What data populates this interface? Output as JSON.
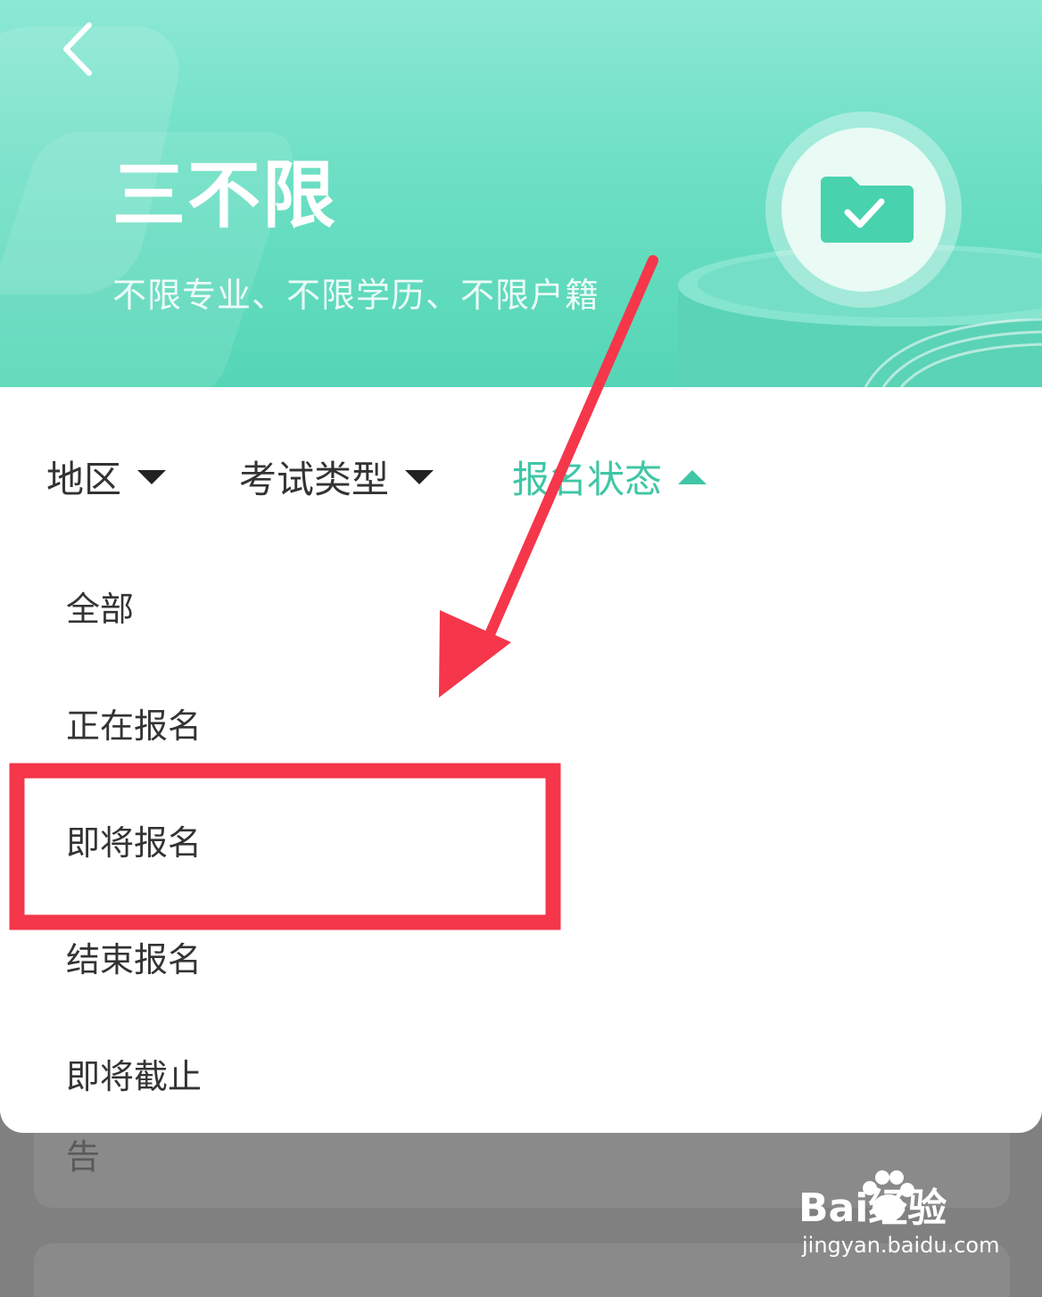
{
  "banner": {
    "title": "三不限",
    "subtitle": "不限专业、不限学历、不限户籍"
  },
  "filters": [
    {
      "label": "地区",
      "state": "collapsed"
    },
    {
      "label": "考试类型",
      "state": "collapsed"
    },
    {
      "label": "报名状态",
      "state": "expanded"
    }
  ],
  "dropdown": {
    "options": [
      "全部",
      "正在报名",
      "即将报名",
      "结束报名",
      "即将截止"
    ],
    "highlighted": "即将报名"
  },
  "background_list": {
    "card_text": "告"
  },
  "watermark": {
    "brand": "Bai经验",
    "url": "jingyan.baidu.com"
  },
  "colors": {
    "accent": "#3fc6a5",
    "annotation": "#f5364b",
    "banner_top": "#8ce8d4",
    "banner_bottom": "#55d6b6"
  },
  "icons": {
    "back": "chevron-left-icon",
    "folder_check": "folder-check-icon"
  }
}
